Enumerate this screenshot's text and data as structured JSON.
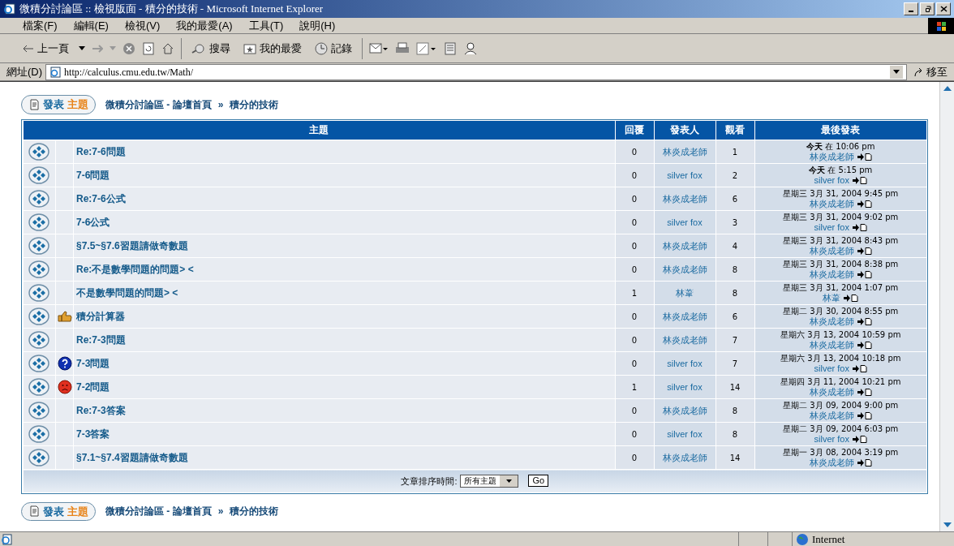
{
  "window": {
    "title": "微積分討論區 :: 檢視版面 - 積分的技術 - Microsoft Internet Explorer"
  },
  "menu": [
    "檔案(F)",
    "編輯(E)",
    "檢視(V)",
    "我的最愛(A)",
    "工具(T)",
    "說明(H)"
  ],
  "toolbar": {
    "back": "上一頁",
    "search": "搜尋",
    "favorites": "我的最愛",
    "history": "記錄"
  },
  "address": {
    "label": "網址(D)",
    "value": "http://calculus.cmu.edu.tw/Math/",
    "go": "移至"
  },
  "forum": {
    "top_nav": {
      "new_topic": {
        "left": "發表",
        "right": "主題"
      },
      "breadcrumb": {
        "home": "微積分討論區 - 論壇首頁",
        "sep": "»",
        "current": "積分的技術"
      }
    },
    "columns": [
      "主題",
      "回覆",
      "發表人",
      "觀看",
      "最後發表"
    ],
    "rows": [
      {
        "topic": "Re:7-6問題",
        "replies": "0",
        "author": "林炎成老師",
        "views": "1",
        "last": "**今天** 在 10:06 pm",
        "last_author": "林炎成老師"
      },
      {
        "topic": "7-6問題",
        "replies": "0",
        "author": "silver fox",
        "views": "2",
        "last": "**今天** 在 5:15 pm",
        "last_author": "silver fox"
      },
      {
        "topic": "Re:7-6公式",
        "replies": "0",
        "author": "林炎成老師",
        "views": "6",
        "last": "星期三 3月 31, 2004 9:45 pm",
        "last_author": "林炎成老師"
      },
      {
        "topic": "7-6公式",
        "replies": "0",
        "author": "silver fox",
        "views": "3",
        "last": "星期三 3月 31, 2004 9:02 pm",
        "last_author": "silver fox"
      },
      {
        "topic": "§7.5~§7.6習題請做奇數題",
        "replies": "0",
        "author": "林炎成老師",
        "views": "4",
        "last": "星期三 3月 31, 2004 8:43 pm",
        "last_author": "林炎成老師"
      },
      {
        "topic": "Re:不是數學問題的問題> <",
        "replies": "0",
        "author": "林炎成老師",
        "views": "8",
        "last": "星期三 3月 31, 2004 8:38 pm",
        "last_author": "林炎成老師"
      },
      {
        "topic": "不是數學問題的問題> <",
        "replies": "1",
        "author": "林葦",
        "views": "8",
        "last": "星期三 3月 31, 2004 1:07 pm",
        "last_author": "林葦"
      },
      {
        "topic": "積分計算器",
        "kind": "thumb",
        "replies": "0",
        "author": "林炎成老師",
        "views": "6",
        "last": "星期二 3月 30, 2004 8:55 pm",
        "last_author": "林炎成老師"
      },
      {
        "topic": "Re:7-3問題",
        "replies": "0",
        "author": "林炎成老師",
        "views": "7",
        "last": "星期六 3月 13, 2004 10:59 pm",
        "last_author": "林炎成老師"
      },
      {
        "topic": "7-3問題",
        "kind": "question",
        "replies": "0",
        "author": "silver fox",
        "views": "7",
        "last": "星期六 3月 13, 2004 10:18 pm",
        "last_author": "silver fox"
      },
      {
        "topic": "7-2問題",
        "kind": "sad",
        "replies": "1",
        "author": "silver fox",
        "views": "14",
        "last": "星期四 3月 11, 2004 10:21 pm",
        "last_author": "林炎成老師"
      },
      {
        "topic": "Re:7-3答案",
        "replies": "0",
        "author": "林炎成老師",
        "views": "8",
        "last": "星期二 3月 09, 2004 9:00 pm",
        "last_author": "林炎成老師"
      },
      {
        "topic": "7-3答案",
        "replies": "0",
        "author": "silver fox",
        "views": "8",
        "last": "星期二 3月 09, 2004 6:03 pm",
        "last_author": "silver fox"
      },
      {
        "topic": "§7.1~§7.4習題請做奇數題",
        "replies": "0",
        "author": "林炎成老師",
        "views": "14",
        "last": "星期一 3月 08, 2004 3:19 pm",
        "last_author": "林炎成老師"
      }
    ],
    "sort": {
      "label": "文章排序時間:",
      "value": "所有主題",
      "go": "Go"
    },
    "bottom_nav": {
      "new_topic": {
        "left": "發表",
        "right": "主題"
      },
      "breadcrumb": {
        "home": "微積分討論區 - 論壇首頁",
        "sep": "»",
        "current": "積分的技術"
      }
    }
  },
  "status_bar": {
    "zone": "Internet"
  }
}
